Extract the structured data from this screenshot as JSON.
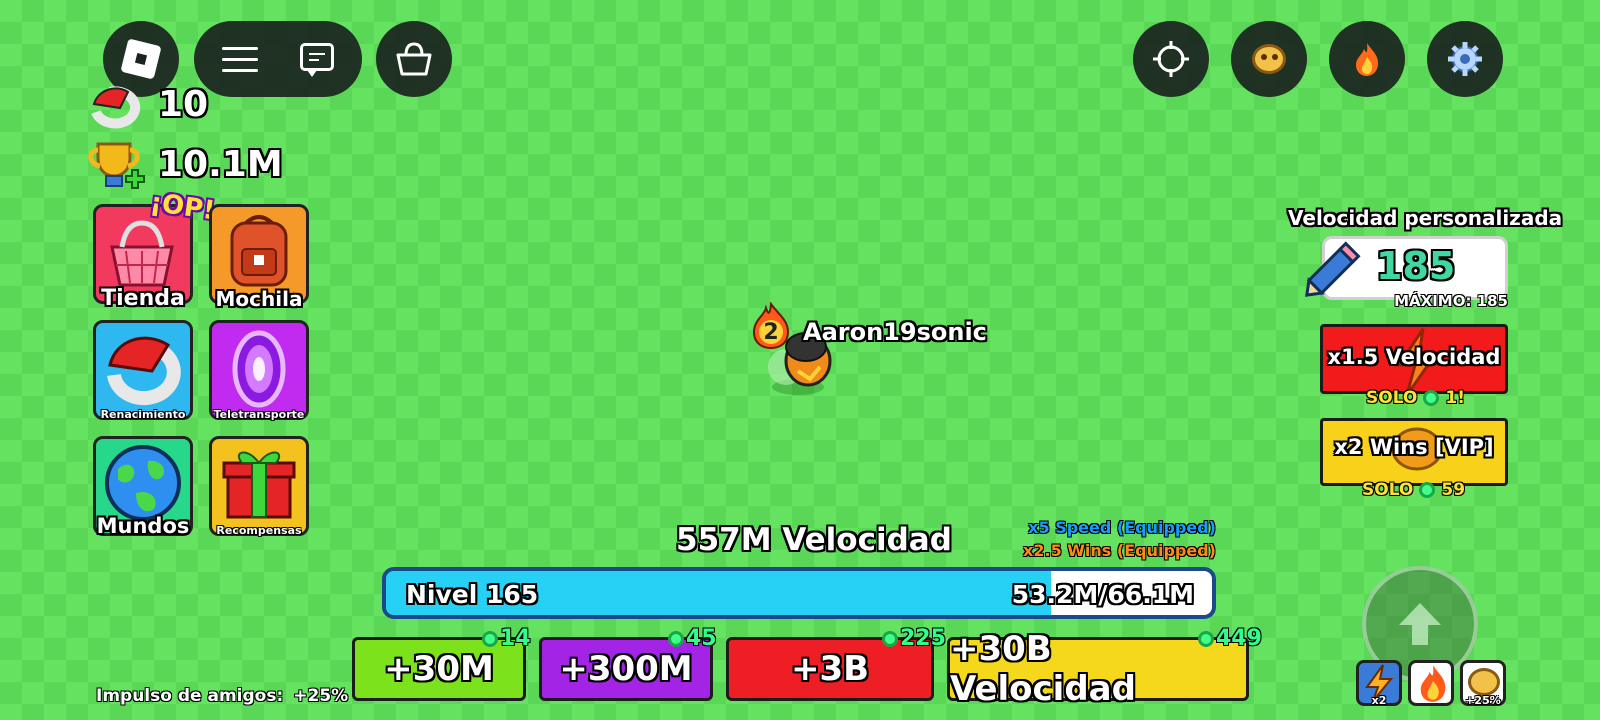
{
  "topbar": {
    "roblox_icon": "roblox-logo-icon",
    "menu_icon": "hamburger-menu-icon",
    "chat_icon": "chat-bubble-icon",
    "shop_icon": "shopping-basket-icon",
    "right_icons": [
      "crosshair-icon",
      "pet-icon",
      "fire-icon",
      "settings-gear-icon"
    ]
  },
  "stats": {
    "rebirths": "10",
    "wins": "10.1M"
  },
  "side_menu": [
    {
      "label": "Tienda",
      "badge": "¡OP!",
      "icon": "basket-icon",
      "color": "#f23a5e"
    },
    {
      "label": "Mochila",
      "icon": "backpack-icon",
      "color": "#f59a2a"
    },
    {
      "label": "Renacimiento",
      "icon": "rebirth-icon",
      "color": "#2fb7f0"
    },
    {
      "label": "Teletransporte",
      "icon": "portal-icon",
      "color": "#c12bf0"
    },
    {
      "label": "Mundos",
      "icon": "globe-icon",
      "color": "#27d88a"
    },
    {
      "label": "Recompensas",
      "icon": "gift-icon",
      "color": "#f4c21e"
    }
  ],
  "player": {
    "rank": "2",
    "name": "Aaron19sonic"
  },
  "custom_speed": {
    "title": "Velocidad personalizada",
    "value": "185",
    "max_label": "MÁXIMO: 185"
  },
  "offers": [
    {
      "label": "x1.5 Velocidad",
      "price_prefix": "SOLO",
      "price": "1!",
      "color": "#f21a1a"
    },
    {
      "label": "x2 Wins [VIP]",
      "price_prefix": "SOLO",
      "price": "59",
      "color": "#f7d11a"
    }
  ],
  "speed": {
    "label": "557M Velocidad",
    "equipped_speed": "x5 Speed (Equipped)",
    "equipped_wins": "x2.5 Wins (Equipped)"
  },
  "level": {
    "label": "Nivel 165",
    "progress_text": "53.2M/66.1M",
    "progress": 0.805
  },
  "boosts": [
    {
      "label": "+30M",
      "cost": "14",
      "color": "#7ce21c"
    },
    {
      "label": "+300M",
      "cost": "45",
      "color": "#a424e6"
    },
    {
      "label": "+3B",
      "cost": "225",
      "color": "#ee1f24"
    },
    {
      "label": "+30B Velocidad",
      "cost": "449",
      "color": "#f5d81b"
    }
  ],
  "friends_boost": {
    "label": "Impulso de amigos:",
    "value": "+25%"
  },
  "jump_button_icon": "up-arrow-icon",
  "mini_boosts": [
    {
      "icon": "lightning-icon",
      "label": "x2"
    },
    {
      "icon": "fire-icon",
      "label": ""
    },
    {
      "icon": "pet-icon",
      "label": "+25%"
    }
  ]
}
